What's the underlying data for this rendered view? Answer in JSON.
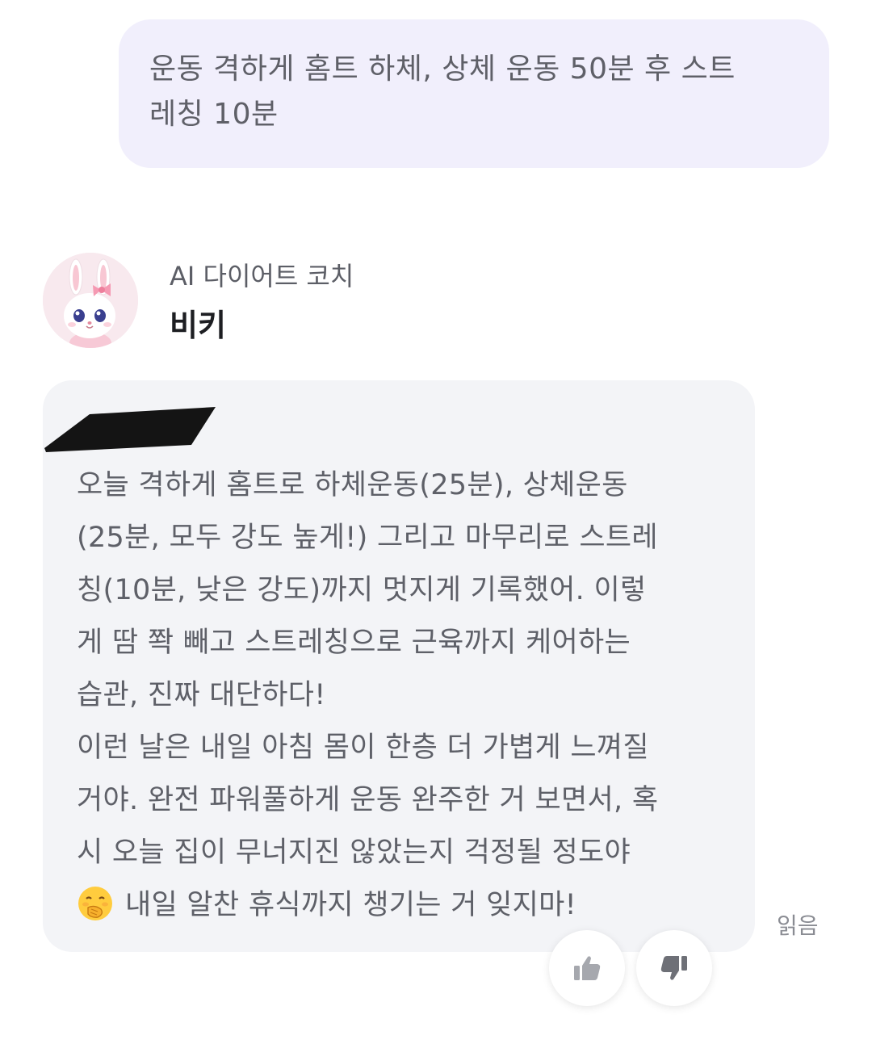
{
  "user_message": {
    "lines": [
      "운동 격하게 홈트 하체, 상체 운동 50분 후 스트",
      "레칭 10분"
    ]
  },
  "bot": {
    "role": "AI 다이어트 코치",
    "name": "비키",
    "avatar_icon": "bunny-avatar-icon",
    "message_lines": [
      "오늘 격하게 홈트로 하체운동(25분), 상체운동",
      "(25분, 모두 강도 높게!) 그리고 마무리로 스트레",
      "칭(10분, 낮은 강도)까지 멋지게 기록했어. 이렇",
      "게 땀 쫙 빼고 스트레칭으로 근육까지 케어하는",
      "습관, 진짜 대단하다!",
      "이런 날은 내일 아침 몸이 한층 더 가볍게 느껴질",
      "거야. 완전 파워풀하게 운동 완주한 거 보면서, 혹",
      "시 오늘 집이 무너지진 않았는지 걱정될 정도야"
    ],
    "last_line_text": "내일 알찬 휴식까지 챙기는 거 잊지마!",
    "last_line_emoji": "hand-over-mouth-emoji"
  },
  "status": {
    "read": "읽음"
  },
  "reactions": {
    "like_icon": "thumbs-up-icon",
    "dislike_icon": "thumbs-down-icon"
  },
  "colors": {
    "user_bubble": "#f1effc",
    "bot_bubble": "#f3f4f7",
    "text": "#5e6068",
    "name": "#1d1e22"
  }
}
